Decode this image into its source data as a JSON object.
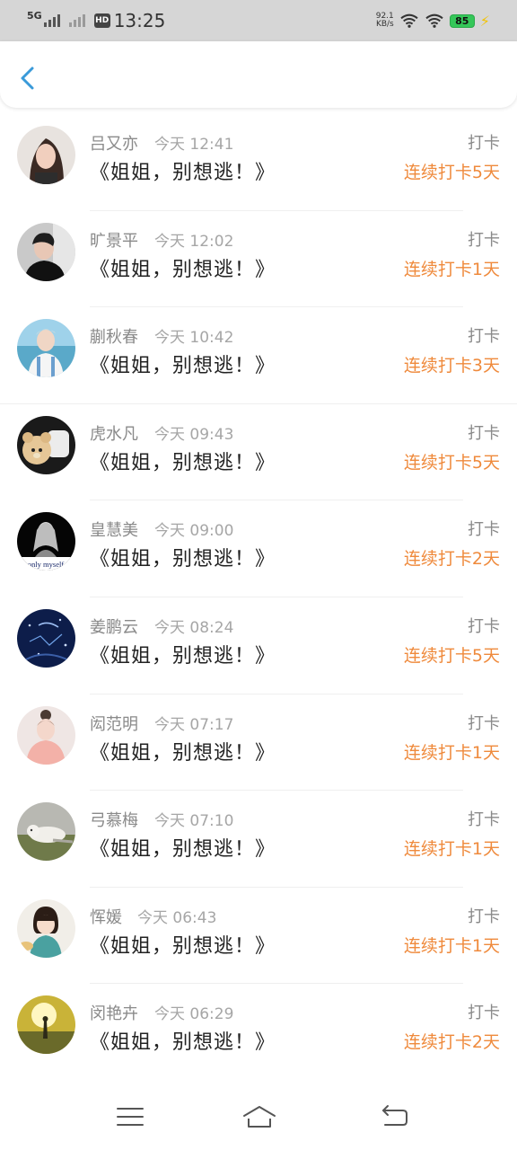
{
  "status_bar": {
    "network_type": "5G",
    "hd_label": "HD",
    "time": "13:25",
    "speed_value": "92.1",
    "speed_unit": "KB/s",
    "battery": "85"
  },
  "header": {
    "back_icon": "chevron-left-icon",
    "accent_color": "#3a9ad9"
  },
  "colors": {
    "streak": "#ef8a3c",
    "name": "#8a8a8a",
    "title": "#222222"
  },
  "checkins": [
    {
      "name": "吕又亦",
      "time": "今天 12:41",
      "title": "《姐姐，别想逃！》",
      "tag": "打卡",
      "streak": "连续打卡5天"
    },
    {
      "name": "旷景平",
      "time": "今天 12:02",
      "title": "《姐姐，别想逃！》",
      "tag": "打卡",
      "streak": "连续打卡1天"
    },
    {
      "name": "蒯秋春",
      "time": "今天 10:42",
      "title": "《姐姐，别想逃！》",
      "tag": "打卡",
      "streak": "连续打卡3天"
    },
    {
      "name": "虎水凡",
      "time": "今天 09:43",
      "title": "《姐姐，别想逃！》",
      "tag": "打卡",
      "streak": "连续打卡5天"
    },
    {
      "name": "皇慧美",
      "time": "今天 09:00",
      "title": "《姐姐，别想逃！》",
      "tag": "打卡",
      "streak": "连续打卡2天",
      "avatar_text": "only myself"
    },
    {
      "name": "姜鹏云",
      "time": "今天 08:24",
      "title": "《姐姐，别想逃！》",
      "tag": "打卡",
      "streak": "连续打卡5天"
    },
    {
      "name": "闳范明",
      "time": "今天 07:17",
      "title": "《姐姐，别想逃！》",
      "tag": "打卡",
      "streak": "连续打卡1天"
    },
    {
      "name": "弓慕梅",
      "time": "今天 07:10",
      "title": "《姐姐，别想逃！》",
      "tag": "打卡",
      "streak": "连续打卡1天"
    },
    {
      "name": "恽媛",
      "time": "今天 06:43",
      "title": "《姐姐，别想逃！》",
      "tag": "打卡",
      "streak": "连续打卡1天"
    },
    {
      "name": "闵艳卉",
      "time": "今天 06:29",
      "title": "《姐姐，别想逃！》",
      "tag": "打卡",
      "streak": "连续打卡2天"
    }
  ],
  "nav_bar": {
    "menu_icon": "menu-icon",
    "home_icon": "home-icon",
    "back_icon": "back-arrow-icon"
  }
}
